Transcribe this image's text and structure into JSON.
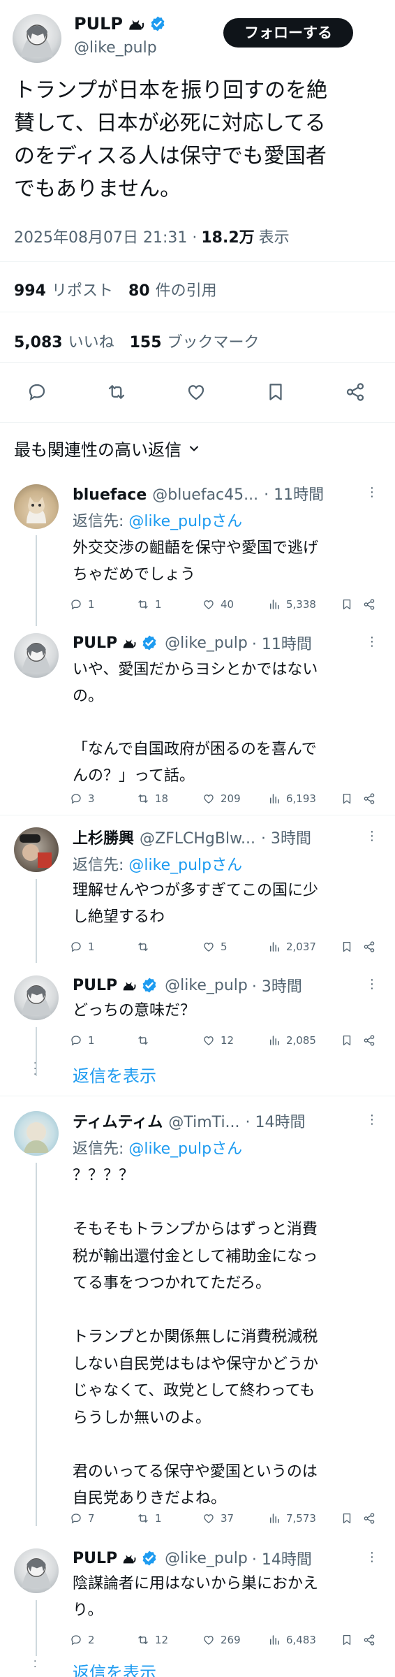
{
  "main": {
    "display_name": "PULP",
    "handle": "@like_pulp",
    "follow_label": "フォローする",
    "text_line1": "トランプが日本を振り回すのを絶",
    "text_line2": "賛して、日本が必死に対応してる",
    "text_line3": "のをディスる人は保守でも愛国者",
    "text_line4": "でもありません。",
    "timestamp": "2025年08月07日 21:31 ·",
    "views_count": "18.2万",
    "views_label": "表示",
    "retweets_count": "994",
    "retweets_label": "リポスト",
    "quotes_count": "80",
    "quotes_label": "件の引用",
    "likes_count": "5,083",
    "likes_label": "いいね",
    "bookmarks_count": "155",
    "bookmarks_label": "ブックマーク"
  },
  "sort_label": "最も関連性の高い返信",
  "replies": [
    {
      "name": "blueface",
      "handle": "@bluefac45...",
      "time": "· 11時間",
      "replying_prefix": "返信先:",
      "replying_to": "@like_pulpさん",
      "lines": [
        "外交交渉の齟齬を保守や愛国で逃げ",
        "ちゃだめでしょう"
      ],
      "stats": {
        "replies": "1",
        "retweets": "1",
        "likes": "40",
        "views": "5,338"
      }
    },
    {
      "name": "PULP",
      "handle": "@like_pulp",
      "time": "· 11時間",
      "lines": [
        "いや、愛国だからヨシとかではない",
        "の。",
        "",
        "「なんで自国政府が困るのを喜んで",
        "んの？」って話。"
      ],
      "stats": {
        "replies": "3",
        "retweets": "18",
        "likes": "209",
        "views": "6,193"
      }
    },
    {
      "name": "上杉勝興",
      "handle": "@ZFLCHgBlw...",
      "time": "· 3時間",
      "replying_prefix": "返信先:",
      "replying_to": "@like_pulpさん",
      "lines": [
        "理解せんやつが多すぎてこの国に少",
        "し絶望するわ"
      ],
      "stats": {
        "replies": "1",
        "retweets": "",
        "likes": "5",
        "views": "2,037"
      }
    },
    {
      "name": "PULP",
      "handle": "@like_pulp",
      "time": "· 3時間",
      "lines": [
        "どっちの意味だ？"
      ],
      "stats": {
        "replies": "1",
        "retweets": "",
        "likes": "12",
        "views": "2,085"
      }
    },
    {
      "name": "ティムティム",
      "handle": "@TimTi...",
      "time": "· 14時間",
      "replying_prefix": "返信先:",
      "replying_to": "@like_pulpさん",
      "lines": [
        "？？？？",
        "",
        "そもそもトランプからはずっと消費",
        "税が輸出還付金として補助金になっ",
        "てる事をつつかれてただろ。",
        "",
        "トランプとか関係無しに消費税減税",
        "しない自民党はもはや保守かどうか",
        "じゃなくて、政党として終わっても",
        "らうしか無いのよ。",
        "",
        "君のいってる保守や愛国というのは",
        "自民党ありきだよね。"
      ],
      "stats": {
        "replies": "7",
        "retweets": "1",
        "likes": "37",
        "views": "7,573"
      }
    },
    {
      "name": "PULP",
      "handle": "@like_pulp",
      "time": "· 14時間",
      "lines": [
        "陰謀論者に用はないから巣におかえ",
        "り。"
      ],
      "stats": {
        "replies": "2",
        "retweets": "12",
        "likes": "269",
        "views": "6,483"
      }
    }
  ],
  "show_replies_label": "返信を表示",
  "colors": {
    "accent": "#1d9bf0",
    "text": "#0f1419",
    "muted": "#536471",
    "verified": "#1d9bf0"
  }
}
